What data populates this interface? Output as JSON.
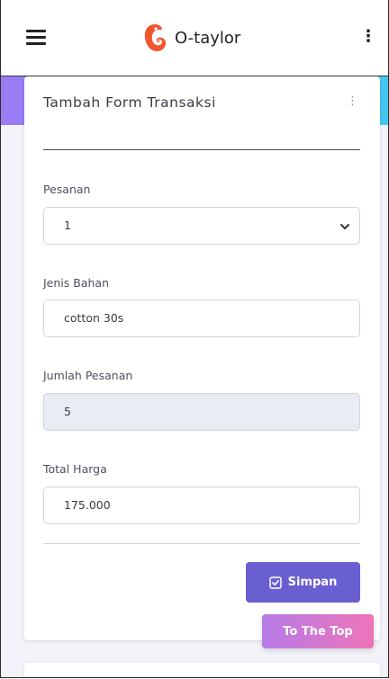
{
  "app": {
    "title": "O-taylor"
  },
  "form": {
    "title": "Tambah Form Transaksi",
    "menu_icon": "vertical-ellipsis",
    "fields": {
      "pesanan": {
        "label": "Pesanan",
        "value": "1"
      },
      "jenis_bahan": {
        "label": "Jenis Bahan",
        "value": "cotton 30s"
      },
      "jumlah_pesanan": {
        "label": "Jumlah Pesanan",
        "value": "5"
      },
      "total_harga": {
        "label": "Total Harga",
        "value": "175.000"
      }
    },
    "submit_label": "Simpan"
  },
  "to_top_label": "To The Top",
  "colors": {
    "primary_button": "#6a5fd0",
    "gradient_left": "#9b7bf4",
    "gradient_right": "#43c9f0",
    "to_top_left": "#b77be8",
    "to_top_right": "#ee74b8",
    "logo": "#f2552c"
  }
}
